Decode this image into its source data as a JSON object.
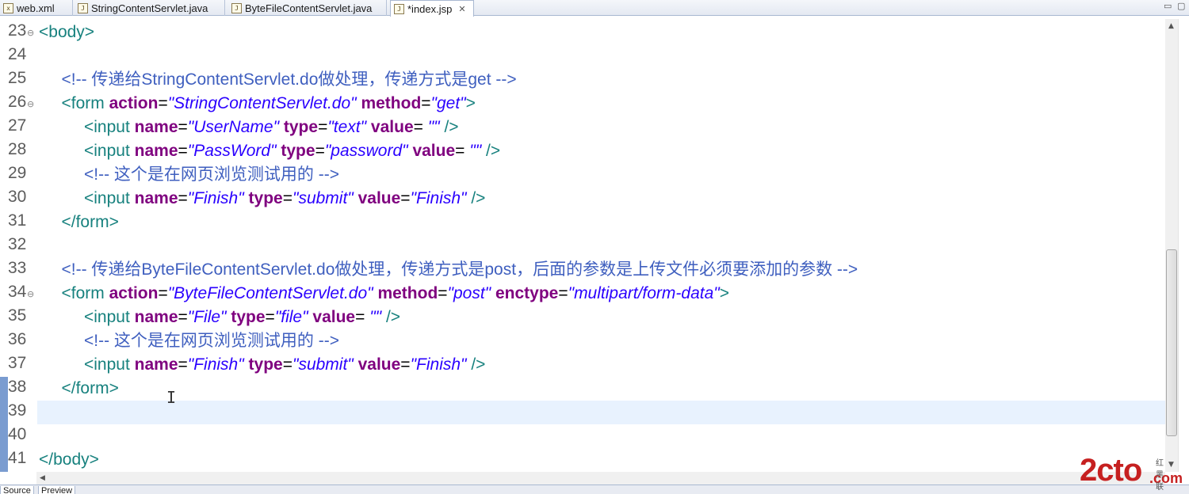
{
  "tabs": [
    {
      "label": "web.xml",
      "icon": "xml-file-icon",
      "glyph": "x"
    },
    {
      "label": "StringContentServlet.java",
      "icon": "java-file-icon",
      "glyph": "J"
    },
    {
      "label": "ByteFileContentServlet.java",
      "icon": "java-file-icon",
      "glyph": "J"
    },
    {
      "label": "*index.jsp",
      "icon": "jsp-file-icon",
      "glyph": "J",
      "active": true
    }
  ],
  "editor": {
    "current_line": 39,
    "lines": [
      {
        "n": "23",
        "tokens": [
          [
            "tag",
            "<body>"
          ]
        ]
      },
      {
        "n": "24",
        "tokens": []
      },
      {
        "n": "25",
        "indent": 1,
        "tokens": [
          [
            "cmt",
            "<!-- 传递给StringContentServlet.do做处理，传递方式是get -->"
          ]
        ]
      },
      {
        "n": "26",
        "indent": 1,
        "tokens": [
          [
            "tag",
            "<form "
          ],
          [
            "attr",
            "action"
          ],
          [
            "eq",
            "="
          ],
          [
            "val",
            "\"StringContentServlet.do\" "
          ],
          [
            "attr",
            "method"
          ],
          [
            "eq",
            "="
          ],
          [
            "val",
            "\"get\""
          ],
          [
            "tag",
            ">"
          ]
        ]
      },
      {
        "n": "27",
        "indent": 2,
        "tokens": [
          [
            "tag",
            "<input "
          ],
          [
            "attr",
            "name"
          ],
          [
            "eq",
            "="
          ],
          [
            "val",
            "\"UserName\" "
          ],
          [
            "attr",
            "type"
          ],
          [
            "eq",
            "="
          ],
          [
            "val",
            "\"text\" "
          ],
          [
            "attr",
            "value"
          ],
          [
            "eq",
            "="
          ],
          [
            "val",
            " \"\" "
          ],
          [
            "tag",
            "/>"
          ]
        ]
      },
      {
        "n": "28",
        "indent": 2,
        "tokens": [
          [
            "tag",
            "<input "
          ],
          [
            "attr",
            "name"
          ],
          [
            "eq",
            "="
          ],
          [
            "val",
            "\"PassWord\" "
          ],
          [
            "attr",
            "type"
          ],
          [
            "eq",
            "="
          ],
          [
            "val",
            "\"password\" "
          ],
          [
            "attr",
            "value"
          ],
          [
            "eq",
            "="
          ],
          [
            "val",
            " \"\" "
          ],
          [
            "tag",
            "/>"
          ]
        ]
      },
      {
        "n": "29",
        "indent": 2,
        "tokens": [
          [
            "cmt",
            "<!-- 这个是在网页浏览测试用的 -->"
          ]
        ]
      },
      {
        "n": "30",
        "indent": 2,
        "tokens": [
          [
            "tag",
            "<input "
          ],
          [
            "attr",
            "name"
          ],
          [
            "eq",
            "="
          ],
          [
            "val",
            "\"Finish\" "
          ],
          [
            "attr",
            "type"
          ],
          [
            "eq",
            "="
          ],
          [
            "val",
            "\"submit\" "
          ],
          [
            "attr",
            "value"
          ],
          [
            "eq",
            "="
          ],
          [
            "val",
            "\"Finish\" "
          ],
          [
            "tag",
            "/>"
          ]
        ]
      },
      {
        "n": "31",
        "indent": 1,
        "tokens": [
          [
            "tag",
            "</form>"
          ]
        ]
      },
      {
        "n": "32",
        "tokens": []
      },
      {
        "n": "33",
        "indent": 1,
        "tokens": [
          [
            "cmt",
            "<!-- 传递给ByteFileContentServlet.do做处理，传递方式是post，后面的参数是上传文件必须要添加的参数 -->"
          ]
        ]
      },
      {
        "n": "34",
        "indent": 1,
        "tokens": [
          [
            "tag",
            "<form "
          ],
          [
            "attr",
            "action"
          ],
          [
            "eq",
            "="
          ],
          [
            "val",
            "\"ByteFileContentServlet.do\" "
          ],
          [
            "attr",
            "method"
          ],
          [
            "eq",
            "="
          ],
          [
            "val",
            "\"post\" "
          ],
          [
            "attr",
            "enctype"
          ],
          [
            "eq",
            "="
          ],
          [
            "val",
            "\"multipart/form-data\""
          ],
          [
            "tag",
            ">"
          ]
        ]
      },
      {
        "n": "35",
        "indent": 2,
        "tokens": [
          [
            "tag",
            "<input "
          ],
          [
            "attr",
            "name"
          ],
          [
            "eq",
            "="
          ],
          [
            "val",
            "\"File\" "
          ],
          [
            "attr",
            "type"
          ],
          [
            "eq",
            "="
          ],
          [
            "val",
            "\"file\" "
          ],
          [
            "attr",
            "value"
          ],
          [
            "eq",
            "="
          ],
          [
            "val",
            " \"\" "
          ],
          [
            "tag",
            "/>"
          ]
        ]
      },
      {
        "n": "36",
        "indent": 2,
        "tokens": [
          [
            "cmt",
            "<!-- 这个是在网页浏览测试用的 -->"
          ]
        ]
      },
      {
        "n": "37",
        "indent": 2,
        "tokens": [
          [
            "tag",
            "<input "
          ],
          [
            "attr",
            "name"
          ],
          [
            "eq",
            "="
          ],
          [
            "val",
            "\"Finish\" "
          ],
          [
            "attr",
            "type"
          ],
          [
            "eq",
            "="
          ],
          [
            "val",
            "\"submit\" "
          ],
          [
            "attr",
            "value"
          ],
          [
            "eq",
            "="
          ],
          [
            "val",
            "\"Finish\" "
          ],
          [
            "tag",
            "/>"
          ]
        ]
      },
      {
        "n": "38",
        "indent": 1,
        "tokens": [
          [
            "tag",
            "</form>"
          ]
        ]
      },
      {
        "n": "39",
        "tokens": []
      },
      {
        "n": "40",
        "tokens": []
      },
      {
        "n": "41",
        "tokens": [
          [
            "tag",
            "</body>"
          ]
        ]
      }
    ],
    "fold_lines": [
      "23",
      "26",
      "34"
    ],
    "change_bars": [
      "38",
      "39",
      "40",
      "41"
    ]
  },
  "bottom_tabs": [
    "Source",
    "Preview"
  ],
  "watermark": {
    "main": "2cto",
    "domain": ".com",
    "sub": "红黑联盟"
  },
  "colors": {
    "tag": "#17817e",
    "attribute": "#7f007f",
    "value": "#2a00ff",
    "comment": "#3f5fbf",
    "current_line": "#e8f2fe"
  }
}
